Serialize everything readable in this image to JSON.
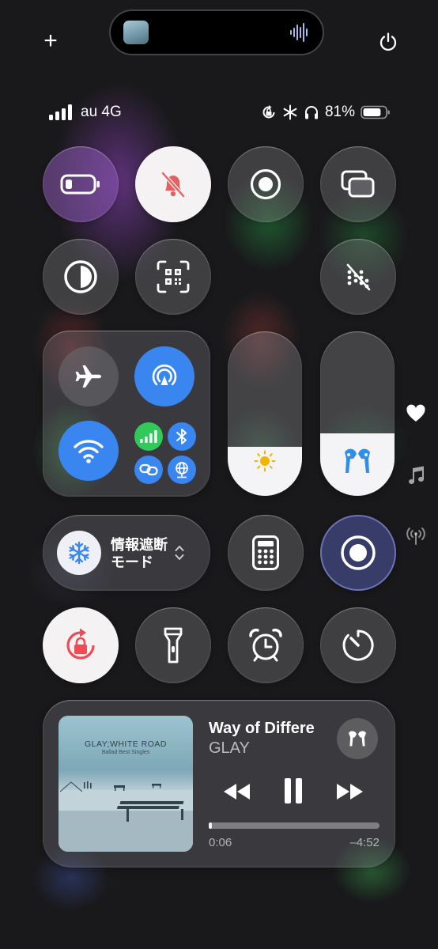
{
  "top_bar": {
    "add_label": "+",
    "island_icon": "waveform-icon",
    "power_icon": "power-icon"
  },
  "status": {
    "carrier": "au 4G",
    "battery_percent": "81%",
    "battery_level": 0.81,
    "icons": [
      "signal-bars-icon",
      "orientation-lock-icon",
      "snowflake-icon",
      "headphones-icon",
      "battery-icon"
    ]
  },
  "controls": [
    {
      "id": "low-power",
      "icon": "battery-low-icon",
      "state": "on"
    },
    {
      "id": "silent-mode",
      "icon": "bell-slash-icon",
      "state": "on"
    },
    {
      "id": "screen-record",
      "icon": "record-icon",
      "state": "off"
    },
    {
      "id": "screen-mirroring",
      "icon": "screen-mirroring-icon",
      "state": "off"
    },
    {
      "id": "dark-mode",
      "icon": "dark-mode-icon",
      "state": "on"
    },
    {
      "id": "code-scanner",
      "icon": "qr-scanner-icon",
      "state": "off"
    },
    {
      "id": "nfc-off",
      "icon": "nfc-slash-icon",
      "state": "off"
    },
    {
      "id": "calculator",
      "icon": "calculator-icon",
      "state": "off"
    },
    {
      "id": "recording",
      "icon": "record-icon",
      "state": "on"
    },
    {
      "id": "rotation-lock",
      "icon": "rotation-lock-icon",
      "state": "on"
    },
    {
      "id": "flashlight",
      "icon": "flashlight-icon",
      "state": "off"
    },
    {
      "id": "alarm",
      "icon": "alarm-clock-icon",
      "state": "off"
    },
    {
      "id": "timer",
      "icon": "timer-icon",
      "state": "off"
    }
  ],
  "connectivity": {
    "airplane": "off",
    "airdrop": "on",
    "wifi": "on",
    "cellular": "on",
    "bluetooth": "on",
    "personal_hotspot": "on",
    "vpn": "on"
  },
  "sliders": {
    "brightness_level": 0.3,
    "volume_level": 0.38
  },
  "focus": {
    "line1": "情報遮断",
    "line2": "モード",
    "icon": "snowflake-icon"
  },
  "now_playing": {
    "title": "Way of Differe",
    "artist": "GLAY",
    "album_title": "GLAY;WHITE ROAD",
    "album_subtitle": "Ballad Best Singles",
    "elapsed": "0:06",
    "remaining": "–4:52",
    "progress": 0.02,
    "output_icon": "airpods-icon"
  },
  "side_icons": [
    "heart-icon",
    "music-note-icon",
    "antenna-icon"
  ],
  "colors": {
    "accent_blue": "#3a86f0",
    "green": "#31c95a",
    "bell_red": "#e5615f",
    "lock_red": "#ef4a55"
  }
}
